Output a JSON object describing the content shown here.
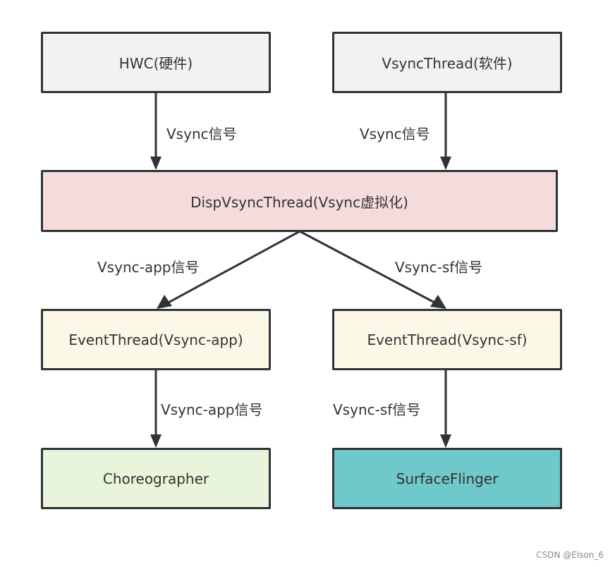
{
  "nodes": {
    "hwc": {
      "label": "HWC(硬件)",
      "fill": "#f2f2f2"
    },
    "vsync_thread": {
      "label": "VsyncThread(软件)",
      "fill": "#f2f2f2"
    },
    "disp_vsync": {
      "label": "DispVsyncThread(Vsync虚拟化)",
      "fill": "#f5dcdc"
    },
    "event_app": {
      "label": "EventThread(Vsync-app)",
      "fill": "#fcf8e8"
    },
    "event_sf": {
      "label": "EventThread(Vsync-sf)",
      "fill": "#fcf8e8"
    },
    "choreographer": {
      "label": "Choreographer",
      "fill": "#e8f4dc"
    },
    "surfaceflinger": {
      "label": "SurfaceFlinger",
      "fill": "#6fc8c9"
    }
  },
  "edges": {
    "hwc_to_disp": "Vsync信号",
    "vsyncthread_to_disp": "Vsync信号",
    "disp_to_app": "Vsync-app信号",
    "disp_to_sf": "Vsync-sf信号",
    "app_to_choreo": "Vsync-app信号",
    "sf_to_surfaceflinger": "Vsync-sf信号"
  },
  "watermark": "CSDN @Elson_6"
}
